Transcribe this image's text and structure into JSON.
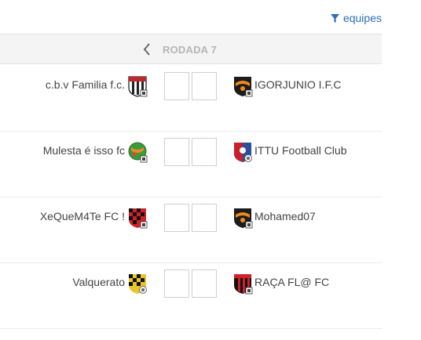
{
  "filter": {
    "label": "equipes",
    "icon": "filter-icon"
  },
  "round": {
    "title": "RODADA 7",
    "prev_icon": "chevron-left-icon"
  },
  "matches": [
    {
      "home": {
        "name": "c.b.v Familia f.c.",
        "badge": "striped-shield-badge-icon"
      },
      "away": {
        "name": "IGORJUNIO I.F.C",
        "badge": "black-orange-shield-badge-icon"
      },
      "home_score": "",
      "away_score": ""
    },
    {
      "home": {
        "name": "Mulesta é isso fc",
        "badge": "green-orange-shield-badge-icon"
      },
      "away": {
        "name": "ITTU Football Club",
        "badge": "blue-red-shield-badge-icon"
      },
      "home_score": "",
      "away_score": ""
    },
    {
      "home": {
        "name": "XeQueM4Te FC !",
        "badge": "red-black-checkered-badge-icon"
      },
      "away": {
        "name": "Mohamed07",
        "badge": "black-orange-shield-badge-icon"
      },
      "home_score": "",
      "away_score": ""
    },
    {
      "home": {
        "name": "Valquerato",
        "badge": "yellow-black-checkered-badge-icon"
      },
      "away": {
        "name": "RAÇA FL@ FC",
        "badge": "red-black-striped-badge-icon"
      },
      "home_score": "",
      "away_score": ""
    }
  ],
  "colors": {
    "accent": "#2a6db5",
    "header_bg": "#f4f4f4",
    "round_title": "#b5b5b5",
    "text": "#444444",
    "border": "#cfcfcf"
  }
}
